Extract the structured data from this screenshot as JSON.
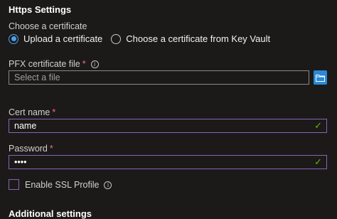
{
  "title": "Https Settings",
  "cert_source": {
    "label": "Choose a certificate",
    "options": [
      "Upload a certificate",
      "Choose a certificate from Key Vault"
    ],
    "selected": "Upload a certificate"
  },
  "pfx": {
    "label": "PFX certificate file",
    "required_mark": "*",
    "info_glyph": "i",
    "placeholder": "Select a file",
    "browse_icon": "folder-icon"
  },
  "cert_name": {
    "label": "Cert name",
    "required_mark": "*",
    "value": "name",
    "valid_glyph": "✓"
  },
  "password": {
    "label": "Password",
    "required_mark": "*",
    "value": "••••",
    "valid_glyph": "✓"
  },
  "ssl_profile": {
    "label": "Enable SSL Profile",
    "info_glyph": "i",
    "checked": false
  },
  "additional_settings": "Additional settings",
  "colors": {
    "background": "#1b1a19",
    "accent": "#4f9ee8",
    "focus_border": "#8764b8",
    "valid": "#6bb700",
    "required": "#f1707b"
  }
}
